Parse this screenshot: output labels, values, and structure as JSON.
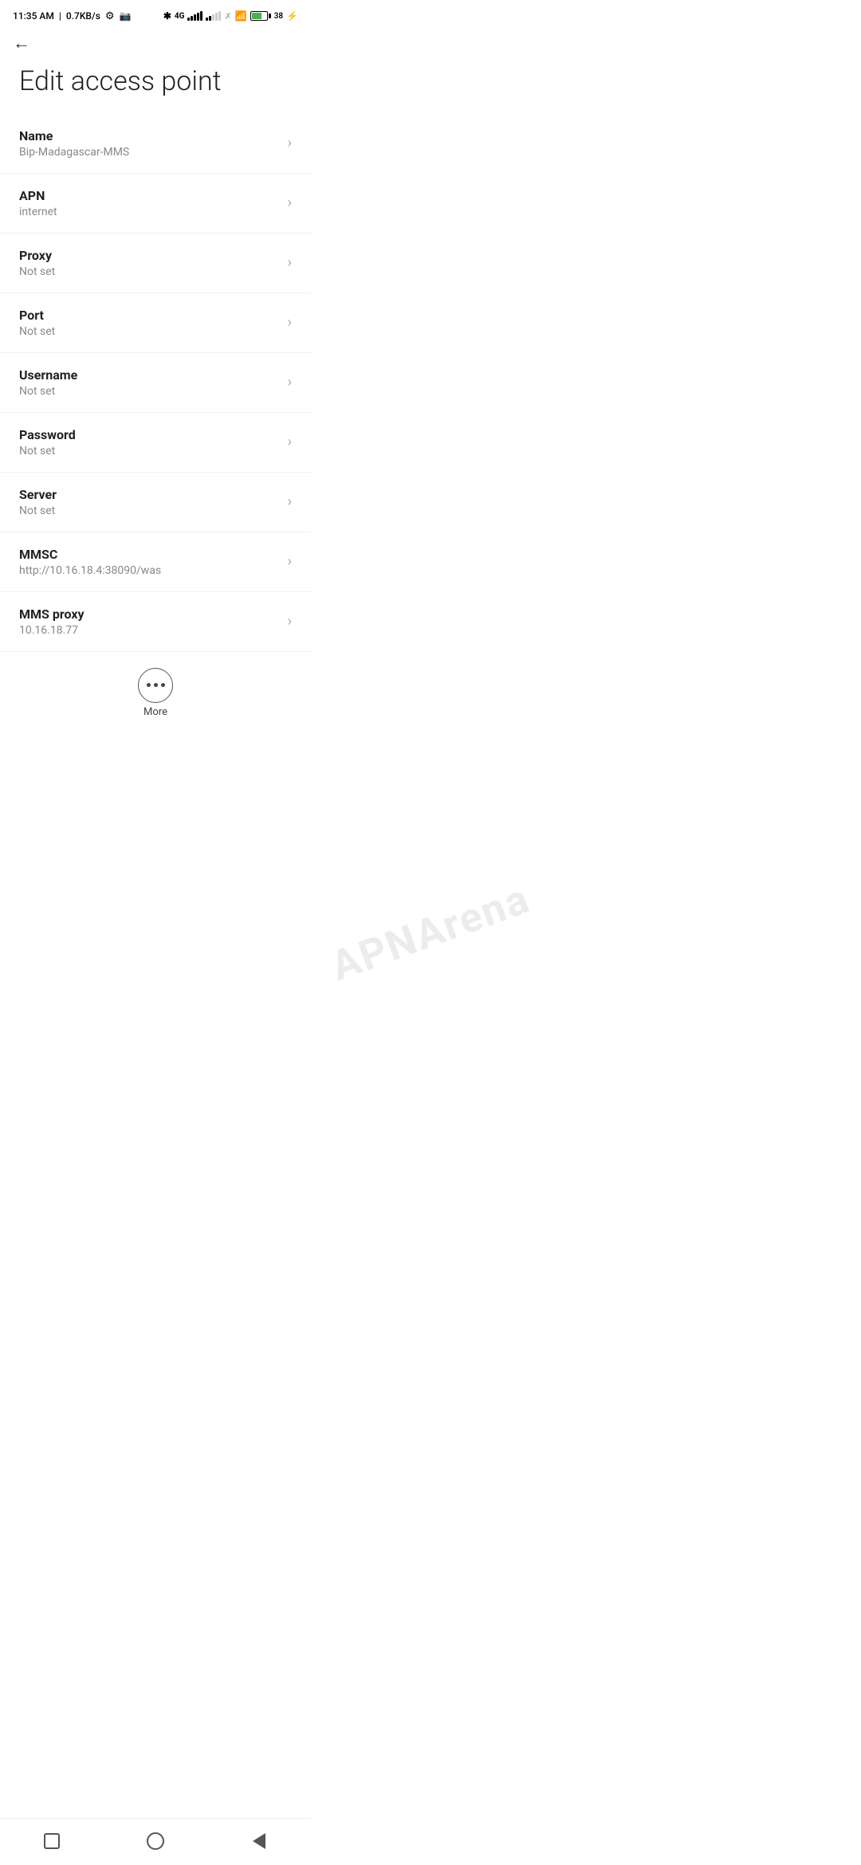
{
  "statusBar": {
    "time": "11:35 AM",
    "network": "0.7KB/s",
    "battery": "38"
  },
  "toolbar": {
    "back_label": "←"
  },
  "page": {
    "title": "Edit access point"
  },
  "settings": [
    {
      "label": "Name",
      "value": "Bip-Madagascar-MMS"
    },
    {
      "label": "APN",
      "value": "internet"
    },
    {
      "label": "Proxy",
      "value": "Not set"
    },
    {
      "label": "Port",
      "value": "Not set"
    },
    {
      "label": "Username",
      "value": "Not set"
    },
    {
      "label": "Password",
      "value": "Not set"
    },
    {
      "label": "Server",
      "value": "Not set"
    },
    {
      "label": "MMSC",
      "value": "http://10.16.18.4:38090/was"
    },
    {
      "label": "MMS proxy",
      "value": "10.16.18.77"
    }
  ],
  "more": {
    "label": "More"
  },
  "watermark": "APNArena"
}
